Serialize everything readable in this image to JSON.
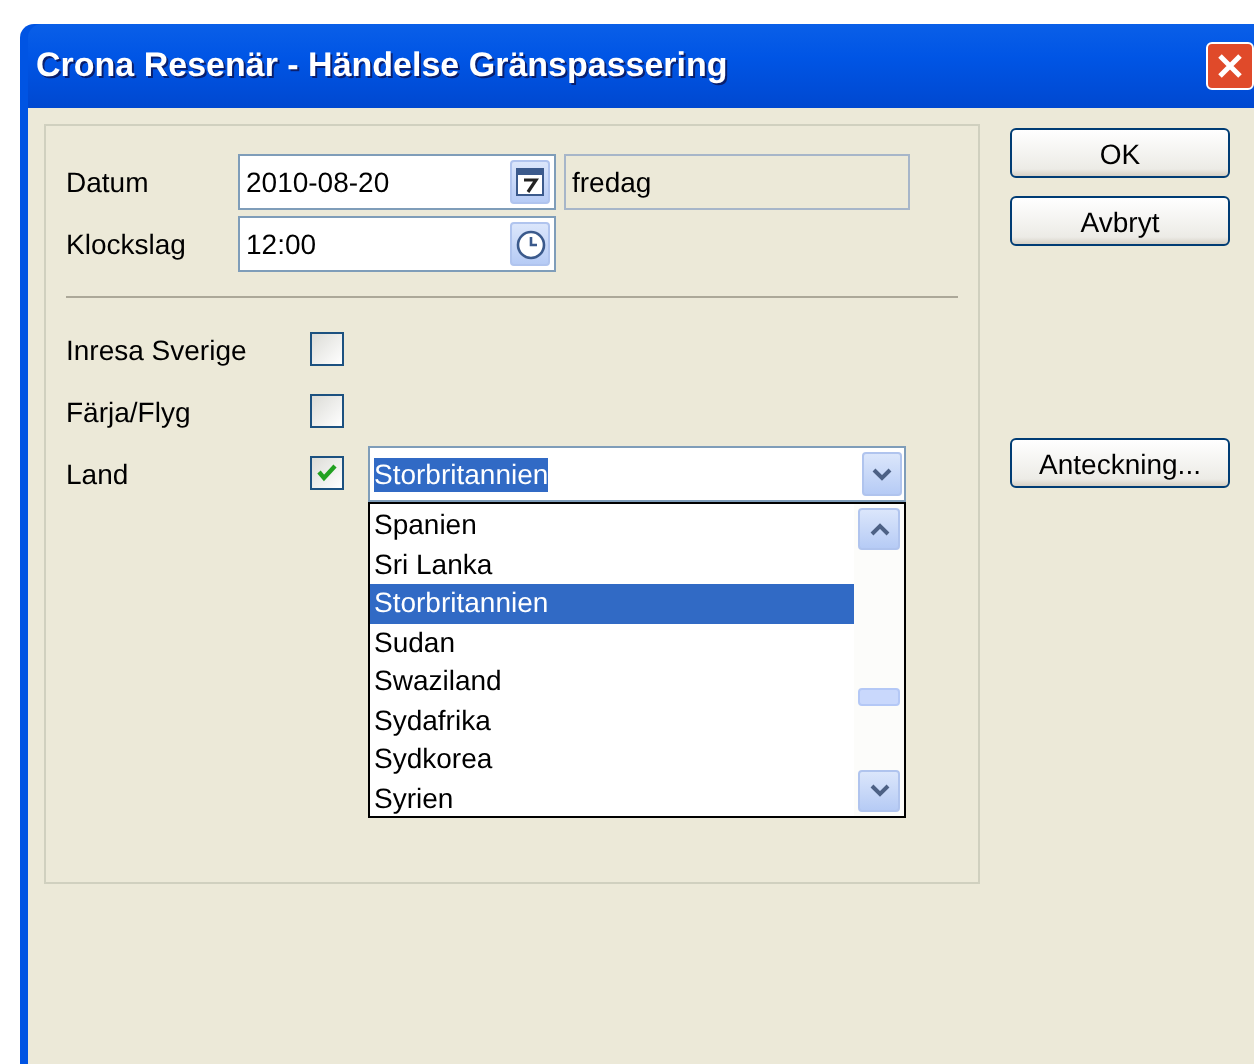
{
  "window": {
    "title": "Crona Resenär - Händelse Gränspassering"
  },
  "fields": [
    {
      "label": "Datum",
      "value": "2010-08-20",
      "kind": "date",
      "aside": "fredag"
    },
    {
      "label": "Klockslag",
      "value": "12:00",
      "kind": "time"
    }
  ],
  "checks": [
    {
      "label": "Inresa Sverige",
      "checked": false
    },
    {
      "label": "Färja/Flyg",
      "checked": false
    },
    {
      "label": "Land",
      "checked": true,
      "combo": {
        "value": "Storbritannien",
        "options": [
          {
            "label": "Spanien",
            "selected": false
          },
          {
            "label": "Sri Lanka",
            "selected": false
          },
          {
            "label": "Storbritannien",
            "selected": true
          },
          {
            "label": "Sudan",
            "selected": false
          },
          {
            "label": "Swaziland",
            "selected": false
          },
          {
            "label": "Sydafrika",
            "selected": false
          },
          {
            "label": "Sydkorea",
            "selected": false
          },
          {
            "label": "Syrien",
            "selected": false
          }
        ]
      }
    }
  ],
  "buttons": [
    "OK",
    "Avbryt"
  ],
  "note_button": "Anteckning..."
}
